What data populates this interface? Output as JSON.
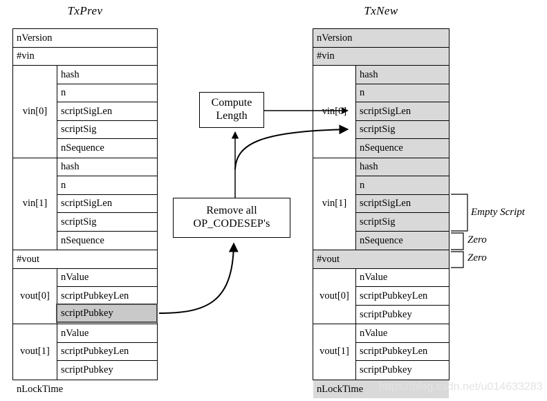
{
  "titles": {
    "prev": "TxPrev",
    "new": "TxNew"
  },
  "tx_prev": {
    "name": "TxPrev",
    "rows": [
      {
        "kind": "full",
        "label": "nVersion",
        "gray": false
      },
      {
        "kind": "full",
        "label": "#vin",
        "gray": false
      },
      {
        "kind": "group",
        "label": "vin[0]",
        "fields": [
          "hash",
          "n",
          "scriptSigLen",
          "scriptSig",
          "nSequence"
        ]
      },
      {
        "kind": "group",
        "label": "vin[1]",
        "fields": [
          "hash",
          "n",
          "scriptSigLen",
          "scriptSig",
          "nSequence"
        ]
      },
      {
        "kind": "full",
        "label": "#vout",
        "gray": false
      },
      {
        "kind": "group",
        "label": "vout[0]",
        "fields": [
          "nValue",
          "scriptPubkeyLen",
          "scriptPubkey"
        ]
      },
      {
        "kind": "group",
        "label": "vout[1]",
        "fields": [
          "nValue",
          "scriptPubkeyLen",
          "scriptPubkey"
        ]
      },
      {
        "kind": "full",
        "label": "nLockTime",
        "gray": false
      }
    ],
    "highlighted_cell": "scriptPubkey"
  },
  "tx_new": {
    "name": "TxNew",
    "rows": [
      {
        "kind": "full",
        "label": "nVersion",
        "gray": true
      },
      {
        "kind": "full",
        "label": "#vin",
        "gray": true
      },
      {
        "kind": "group",
        "label": "vin[0]",
        "fields": [
          "hash",
          "n",
          "scriptSigLen",
          "scriptSig",
          "nSequence"
        ],
        "gray": true
      },
      {
        "kind": "group",
        "label": "vin[1]",
        "fields": [
          "hash",
          "n",
          "scriptSigLen",
          "scriptSig",
          "nSequence"
        ],
        "gray": true
      },
      {
        "kind": "full",
        "label": "#vout",
        "gray": true
      },
      {
        "kind": "group",
        "label": "vout[0]",
        "fields": [
          "nValue",
          "scriptPubkeyLen",
          "scriptPubkey"
        ],
        "gray": false
      },
      {
        "kind": "group",
        "label": "vout[1]",
        "fields": [
          "nValue",
          "scriptPubkeyLen",
          "scriptPubkey"
        ],
        "gray": false
      },
      {
        "kind": "full",
        "label": "nLockTime",
        "gray": true
      }
    ]
  },
  "process_boxes": {
    "compute_length": {
      "line1": "Compute",
      "line2": "Length"
    },
    "remove_codesep": {
      "line1": "Remove all",
      "line2": "OP_CODESEP's"
    }
  },
  "annotations": {
    "empty_script": "Empty Script",
    "zero_sequence": "Zero",
    "zero_vout": "Zero"
  },
  "watermark": "https://blog.csdn.net/u014633283",
  "colors": {
    "gray_fill": "#d9d9d9",
    "highlight_fill": "#c9c9c9",
    "highlight_border": "#4d4d4d",
    "stroke": "#000000",
    "watermark": "#e3e3e3"
  }
}
